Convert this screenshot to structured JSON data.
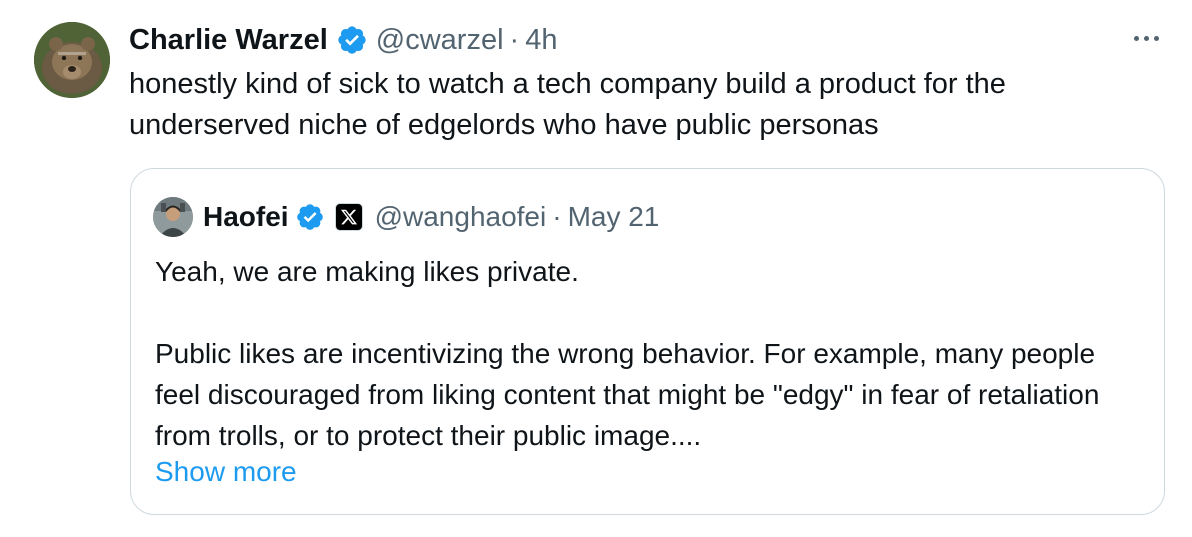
{
  "tweet": {
    "author_name": "Charlie Warzel",
    "handle": "@cwarzel",
    "separator": "·",
    "time": "4h",
    "text": "honestly kind of sick to watch a tech company build a product for the underserved niche of edgelords who have public personas"
  },
  "quoted_tweet": {
    "author_name": "Haofei",
    "handle": "@wanghaofei",
    "separator": "·",
    "time": "May 21",
    "paragraph_1": "Yeah, we are making likes private.",
    "paragraph_2": "Public likes are incentivizing the wrong behavior. For example, many people feel discouraged from liking content that might be \"edgy\" in fear of retaliation from trolls, or to protect their public image....",
    "show_more": "Show more"
  },
  "icons": {
    "verified": "verified-badge-icon",
    "affiliate": "x-logo-icon",
    "more": "more-options-icon"
  },
  "colors": {
    "verified_blue": "#1d9bf0",
    "link_blue": "#1d9bf0",
    "secondary_text": "#536471",
    "border": "#cfd9de"
  }
}
